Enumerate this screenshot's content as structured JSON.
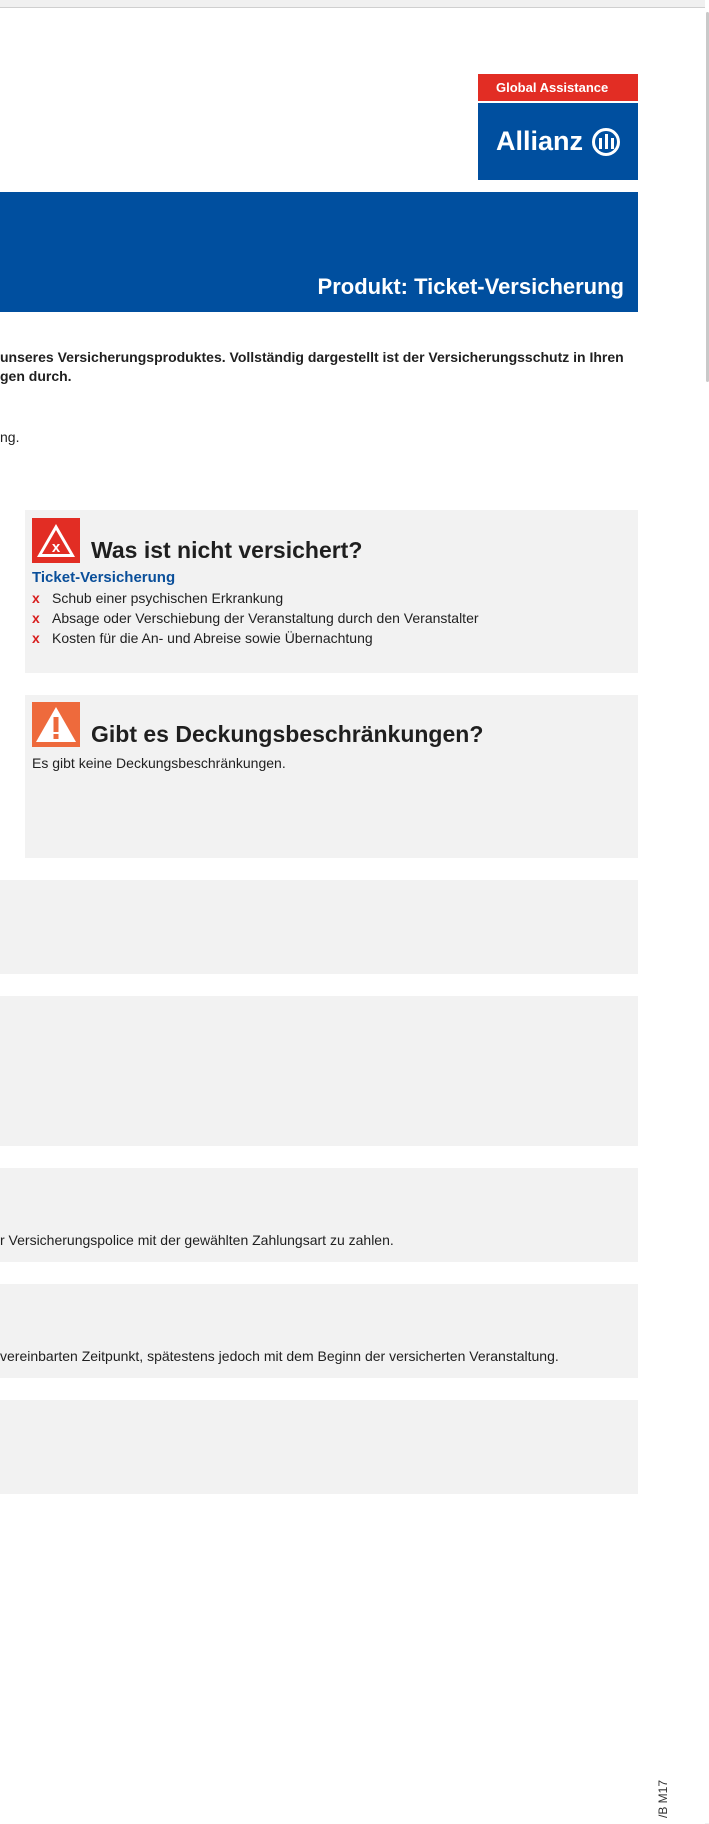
{
  "brand": {
    "tagline": "Global Assistance",
    "name": "Allianz",
    "logo_icon": "allianz-eagle-icon",
    "colors": {
      "red": "#e22d24",
      "blue": "#004f9f"
    }
  },
  "header": {
    "product_title": "Produkt: Ticket-Versicherung"
  },
  "intro": {
    "text": "unseres Versicherungsproduktes. Vollständig dargestellt ist der Versicherungsschutz in Ihren gen durch.",
    "continuation": "ng."
  },
  "not_insured": {
    "icon": "x-warning-icon",
    "title": "Was ist nicht versichert?",
    "section_label": "Ticket-Versicherung",
    "marker": "x",
    "items": [
      "Schub einer psychischen Erkrankung",
      "Absage oder Verschiebung der Veranstaltung durch den Veranstalter",
      "Kosten für die An- und Abreise sowie Übernachtung"
    ]
  },
  "restrictions": {
    "icon": "exclamation-warning-icon",
    "title": "Gibt es Deckungsbeschränkungen?",
    "text": "Es gibt keine Deckungsbeschränkungen."
  },
  "payment": {
    "text": "r Versicherungspolice mit der gewählten Zahlungsart zu zahlen."
  },
  "coverage_start": {
    "text": "vereinbarten Zeitpunkt, spätestens jedoch mit dem Beginn der versicherten Veranstaltung."
  },
  "footer": {
    "code": "/B M17"
  }
}
